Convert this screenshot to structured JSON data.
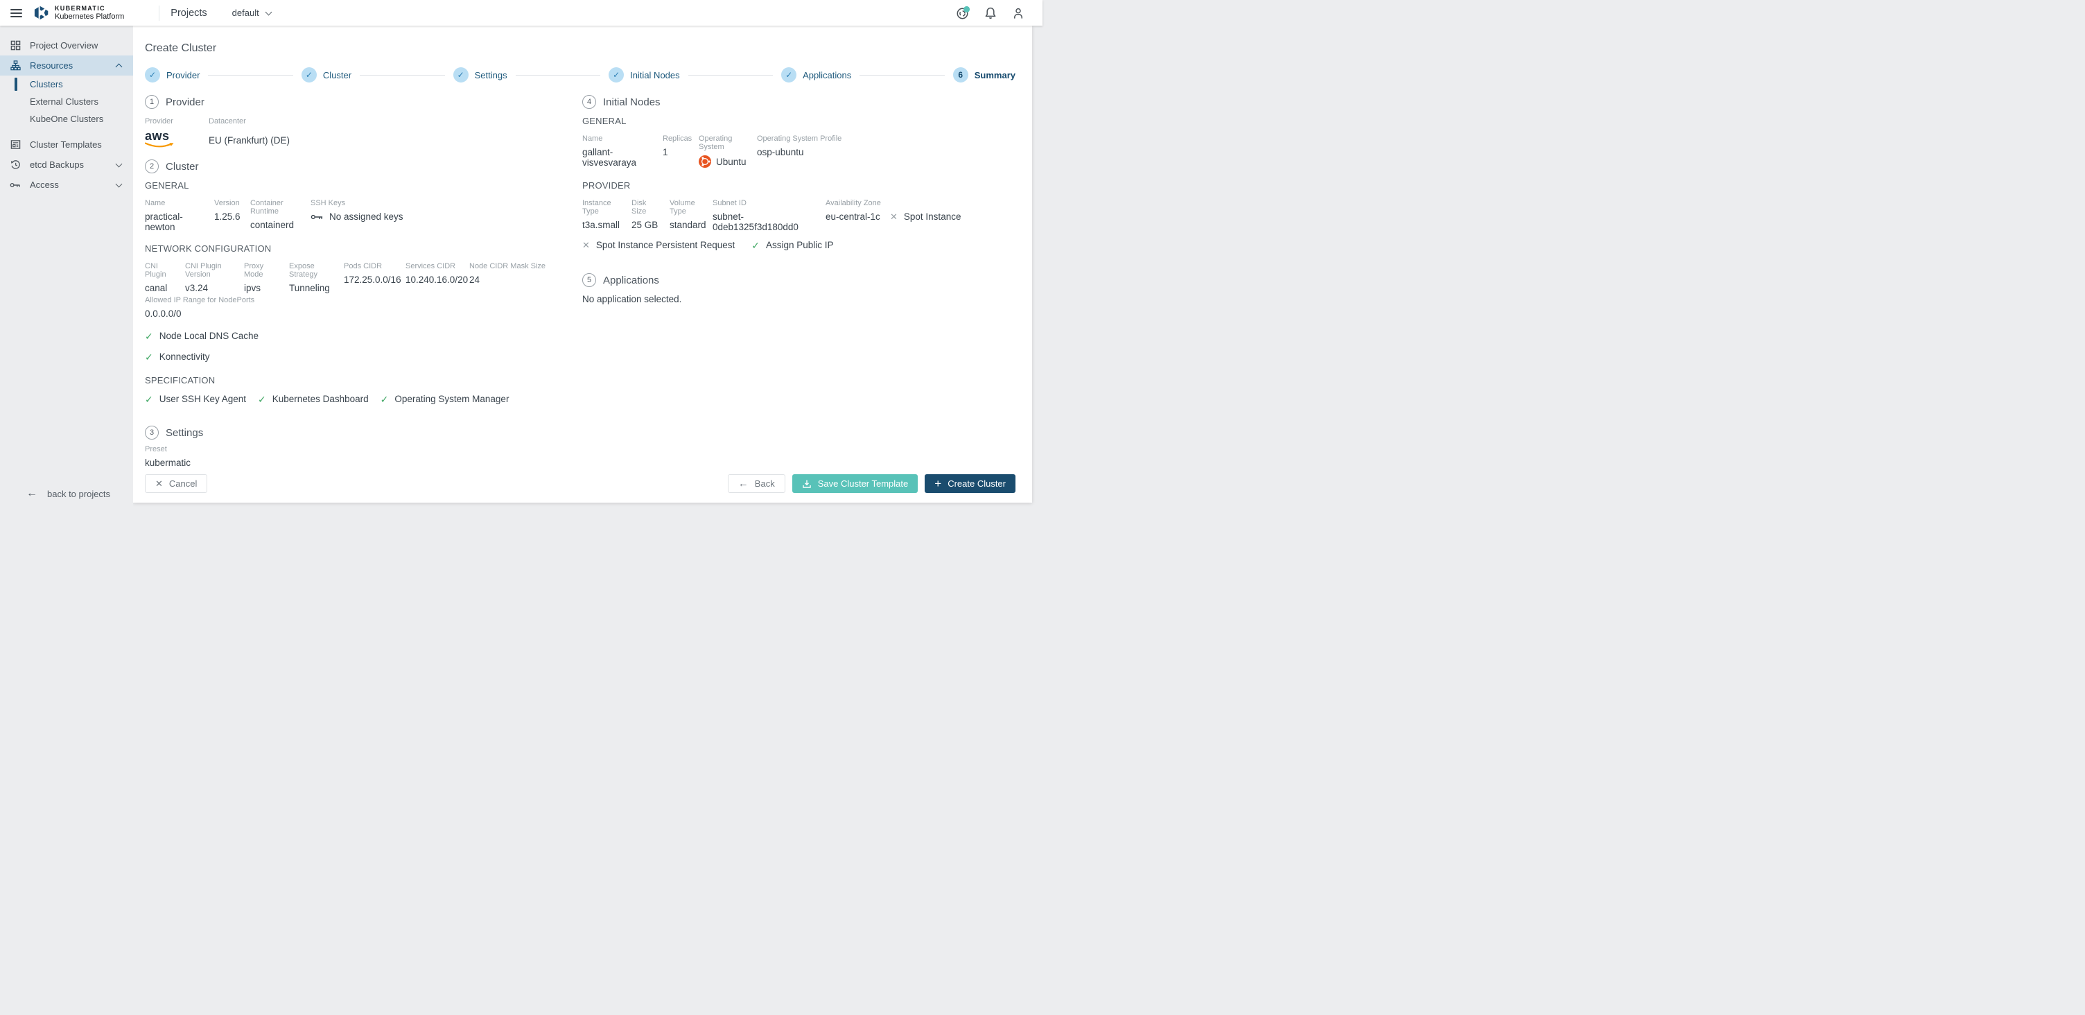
{
  "icons": {
    "check": "✓",
    "cross": "✕",
    "back_arrow": "←",
    "plus": "+",
    "close": "✕"
  },
  "topbar": {
    "brand_line1": "KUBERMATIC",
    "brand_line2": "Kubernetes Platform",
    "nav_title": "Projects",
    "project_selected": "default"
  },
  "sidebar": {
    "project_overview": "Project Overview",
    "resources": "Resources",
    "clusters": "Clusters",
    "external_clusters": "External Clusters",
    "kubeone_clusters": "KubeOne Clusters",
    "cluster_templates": "Cluster Templates",
    "etcd_backups": "etcd Backups",
    "access": "Access",
    "back_to_projects": "back to projects"
  },
  "wizard": {
    "title": "Create Cluster",
    "steps": [
      {
        "label": "Provider",
        "state": "done"
      },
      {
        "label": "Cluster",
        "state": "done"
      },
      {
        "label": "Settings",
        "state": "done"
      },
      {
        "label": "Initial Nodes",
        "state": "done"
      },
      {
        "label": "Applications",
        "state": "done"
      },
      {
        "label": "Summary",
        "number": "6",
        "state": "current"
      }
    ]
  },
  "provider_section": {
    "number": "1",
    "title": "Provider",
    "provider_label": "Provider",
    "provider_value": "aws",
    "datacenter_label": "Datacenter",
    "datacenter_value": "EU (Frankfurt) (DE)"
  },
  "cluster_section": {
    "number": "2",
    "title": "Cluster",
    "general_header": "GENERAL",
    "general_fields": [
      {
        "label": "Name",
        "value": "practical-newton"
      },
      {
        "label": "Version",
        "value": "1.25.6"
      },
      {
        "label": "Container Runtime",
        "value": "containerd"
      },
      {
        "label": "SSH Keys",
        "value": "No assigned keys"
      }
    ],
    "network_header": "NETWORK CONFIGURATION",
    "network_fields": [
      {
        "label": "CNI Plugin",
        "value": "canal"
      },
      {
        "label": "CNI Plugin Version",
        "value": "v3.24"
      },
      {
        "label": "Proxy Mode",
        "value": "ipvs"
      },
      {
        "label": "Expose Strategy",
        "value": "Tunneling"
      },
      {
        "label": "Pods CIDR",
        "value": "172.25.0.0/16"
      },
      {
        "label": "Services CIDR",
        "value": "10.240.16.0/20"
      },
      {
        "label": "Node CIDR Mask Size",
        "value": "24"
      }
    ],
    "allowed_ip_label": "Allowed IP Range for NodePorts",
    "allowed_ip_value": "0.0.0.0/0",
    "features": [
      {
        "label": "Node Local DNS Cache",
        "enabled": true
      },
      {
        "label": "Konnectivity",
        "enabled": true
      }
    ],
    "spec_header": "SPECIFICATION",
    "spec_features": [
      {
        "label": "User SSH Key Agent",
        "enabled": true
      },
      {
        "label": "Kubernetes Dashboard",
        "enabled": true
      },
      {
        "label": "Operating System Manager",
        "enabled": true
      }
    ]
  },
  "settings_section": {
    "number": "3",
    "title": "Settings",
    "preset_label": "Preset",
    "preset_value": "kubermatic"
  },
  "nodes_section": {
    "number": "4",
    "title": "Initial Nodes",
    "general_header": "GENERAL",
    "general_fields": [
      {
        "label": "Name",
        "value": "gallant-visvesvaraya"
      },
      {
        "label": "Replicas",
        "value": "1"
      },
      {
        "label": "Operating System",
        "value": "Ubuntu"
      },
      {
        "label": "Operating System Profile",
        "value": "osp-ubuntu"
      }
    ],
    "provider_header": "PROVIDER",
    "provider_fields": [
      {
        "label": "Instance Type",
        "value": "t3a.small"
      },
      {
        "label": "Disk Size",
        "value": "25 GB"
      },
      {
        "label": "Volume Type",
        "value": "standard"
      },
      {
        "label": "Subnet ID",
        "value": "subnet-0deb1325f3d180dd0"
      },
      {
        "label": "Availability Zone",
        "value": "eu-central-1c"
      }
    ],
    "flag_spot_instance": "Spot Instance",
    "flag_spot_persistent": "Spot Instance Persistent Request",
    "flag_assign_public_ip": "Assign Public IP"
  },
  "applications_section": {
    "number": "5",
    "title": "Applications",
    "empty_text": "No application selected."
  },
  "footer": {
    "cancel": "Cancel",
    "back": "Back",
    "save_template": "Save Cluster Template",
    "create": "Create Cluster"
  },
  "colors": {
    "accent_teal": "#58c2b8",
    "primary_dark_blue": "#1a4c6e",
    "step_circle_bg": "#b9def4",
    "step_text": "#1d597c",
    "success_green": "#3fa763",
    "ubuntu_orange": "#e85420",
    "aws_smile_orange": "#f79800",
    "sidebar_active_bg": "#cfdfeb",
    "sidebar_active_text": "#1d5378"
  }
}
